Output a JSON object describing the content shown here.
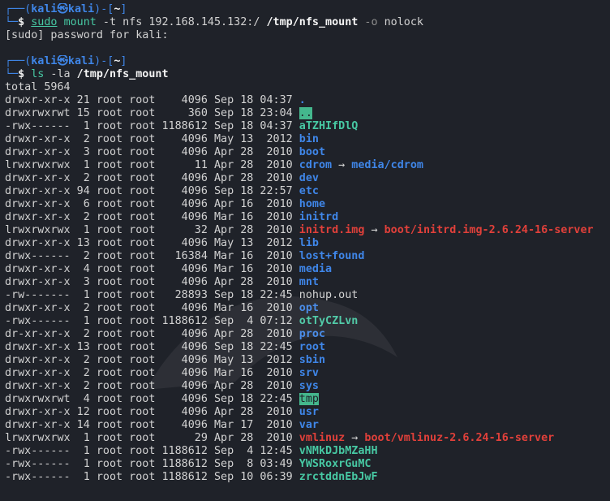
{
  "prompt": {
    "top_left": "┌──(",
    "user": "kali",
    "skull": "㉿",
    "host": "kali",
    "mid": ")-[",
    "path": "~",
    "end": "]",
    "bottom_left": "└─",
    "dollar": "$"
  },
  "commands": [
    {
      "sudo": "sudo",
      "cmd": "mount",
      "args1": " -t nfs 192.168.145.132:/ ",
      "argbold": "/tmp/nfs_mount",
      "opt": " -o",
      "args2": " nolock"
    },
    {
      "cmd": "ls",
      "opt": " -la",
      "argbold": " /tmp/nfs_mount"
    }
  ],
  "sudo_prompt": "[sudo] password for kali:",
  "total": "total 5964",
  "listing": [
    {
      "meta": "drwxr-xr-x 21 root root    4096 Sep 18 04:37 ",
      "name": ".",
      "kind": "dir"
    },
    {
      "meta": "drwxrwxrwt 15 root root     360 Sep 18 23:04 ",
      "name": "..",
      "kind": "sticky"
    },
    {
      "meta": "-rwx------  1 root root 1188612 Sep 18 04:37 ",
      "name": "aTZHIfDlQ",
      "kind": "exe"
    },
    {
      "meta": "drwxr-xr-x  2 root root    4096 May 13  2012 ",
      "name": "bin",
      "kind": "dir"
    },
    {
      "meta": "drwxr-xr-x  3 root root    4096 Apr 28  2010 ",
      "name": "boot",
      "kind": "dir"
    },
    {
      "meta": "lrwxrwxrwx  1 root root      11 Apr 28  2010 ",
      "name": "cdrom",
      "kind": "link",
      "target": "media/cdrom",
      "target_kind": "dir"
    },
    {
      "meta": "drwxr-xr-x  2 root root    4096 Apr 28  2010 ",
      "name": "dev",
      "kind": "dir"
    },
    {
      "meta": "drwxr-xr-x 94 root root    4096 Sep 18 22:57 ",
      "name": "etc",
      "kind": "dir"
    },
    {
      "meta": "drwxr-xr-x  6 root root    4096 Apr 16  2010 ",
      "name": "home",
      "kind": "dir"
    },
    {
      "meta": "drwxr-xr-x  2 root root    4096 Mar 16  2010 ",
      "name": "initrd",
      "kind": "dir"
    },
    {
      "meta": "lrwxrwxrwx  1 root root      32 Apr 28  2010 ",
      "name": "initrd.img",
      "kind": "broken",
      "target": "boot/initrd.img-2.6.24-16-server",
      "target_kind": "broken"
    },
    {
      "meta": "drwxr-xr-x 13 root root    4096 May 13  2012 ",
      "name": "lib",
      "kind": "dir"
    },
    {
      "meta": "drwx------  2 root root   16384 Mar 16  2010 ",
      "name": "lost+found",
      "kind": "dir"
    },
    {
      "meta": "drwxr-xr-x  4 root root    4096 Mar 16  2010 ",
      "name": "media",
      "kind": "dir"
    },
    {
      "meta": "drwxr-xr-x  3 root root    4096 Apr 28  2010 ",
      "name": "mnt",
      "kind": "dir"
    },
    {
      "meta": "-rw-------  1 root root   28893 Sep 18 22:45 ",
      "name": "nohup.out",
      "kind": "plain"
    },
    {
      "meta": "drwxr-xr-x  2 root root    4096 Mar 16  2010 ",
      "name": "opt",
      "kind": "dir"
    },
    {
      "meta": "-rwx------  1 root root 1188612 Sep  4 07:12 ",
      "name": "otTyCZLvn",
      "kind": "exe"
    },
    {
      "meta": "dr-xr-xr-x  2 root root    4096 Apr 28  2010 ",
      "name": "proc",
      "kind": "dir"
    },
    {
      "meta": "drwxr-xr-x 13 root root    4096 Sep 18 22:45 ",
      "name": "root",
      "kind": "dir"
    },
    {
      "meta": "drwxr-xr-x  2 root root    4096 May 13  2012 ",
      "name": "sbin",
      "kind": "dir"
    },
    {
      "meta": "drwxr-xr-x  2 root root    4096 Mar 16  2010 ",
      "name": "srv",
      "kind": "dir"
    },
    {
      "meta": "drwxr-xr-x  2 root root    4096 Apr 28  2010 ",
      "name": "sys",
      "kind": "dir"
    },
    {
      "meta": "drwxrwxrwt  4 root root    4096 Sep 18 22:45 ",
      "name": "tmp",
      "kind": "sticky"
    },
    {
      "meta": "drwxr-xr-x 12 root root    4096 Apr 28  2010 ",
      "name": "usr",
      "kind": "dir"
    },
    {
      "meta": "drwxr-xr-x 14 root root    4096 Mar 17  2010 ",
      "name": "var",
      "kind": "dir"
    },
    {
      "meta": "lrwxrwxrwx  1 root root      29 Apr 28  2010 ",
      "name": "vmlinuz",
      "kind": "broken",
      "target": "boot/vmlinuz-2.6.24-16-server",
      "target_kind": "broken"
    },
    {
      "meta": "-rwx------  1 root root 1188612 Sep  4 12:45 ",
      "name": "vNMkDJbMZaHH",
      "kind": "exe"
    },
    {
      "meta": "-rwx------  1 root root 1188612 Sep  8 03:49 ",
      "name": "YWSRoxrGuMC",
      "kind": "exe"
    },
    {
      "meta": "-rwx------  1 root root 1188612 Sep 10 06:39 ",
      "name": "zrctddnEbJwF",
      "kind": "exe"
    }
  ],
  "link_arrow": " → ",
  "colors": {
    "background": "#1f2229",
    "prompt_blue": "#3f86e8",
    "command_green": "#47c8a3",
    "broken_red": "#e0403a",
    "sticky_bg": "#44b78d"
  }
}
